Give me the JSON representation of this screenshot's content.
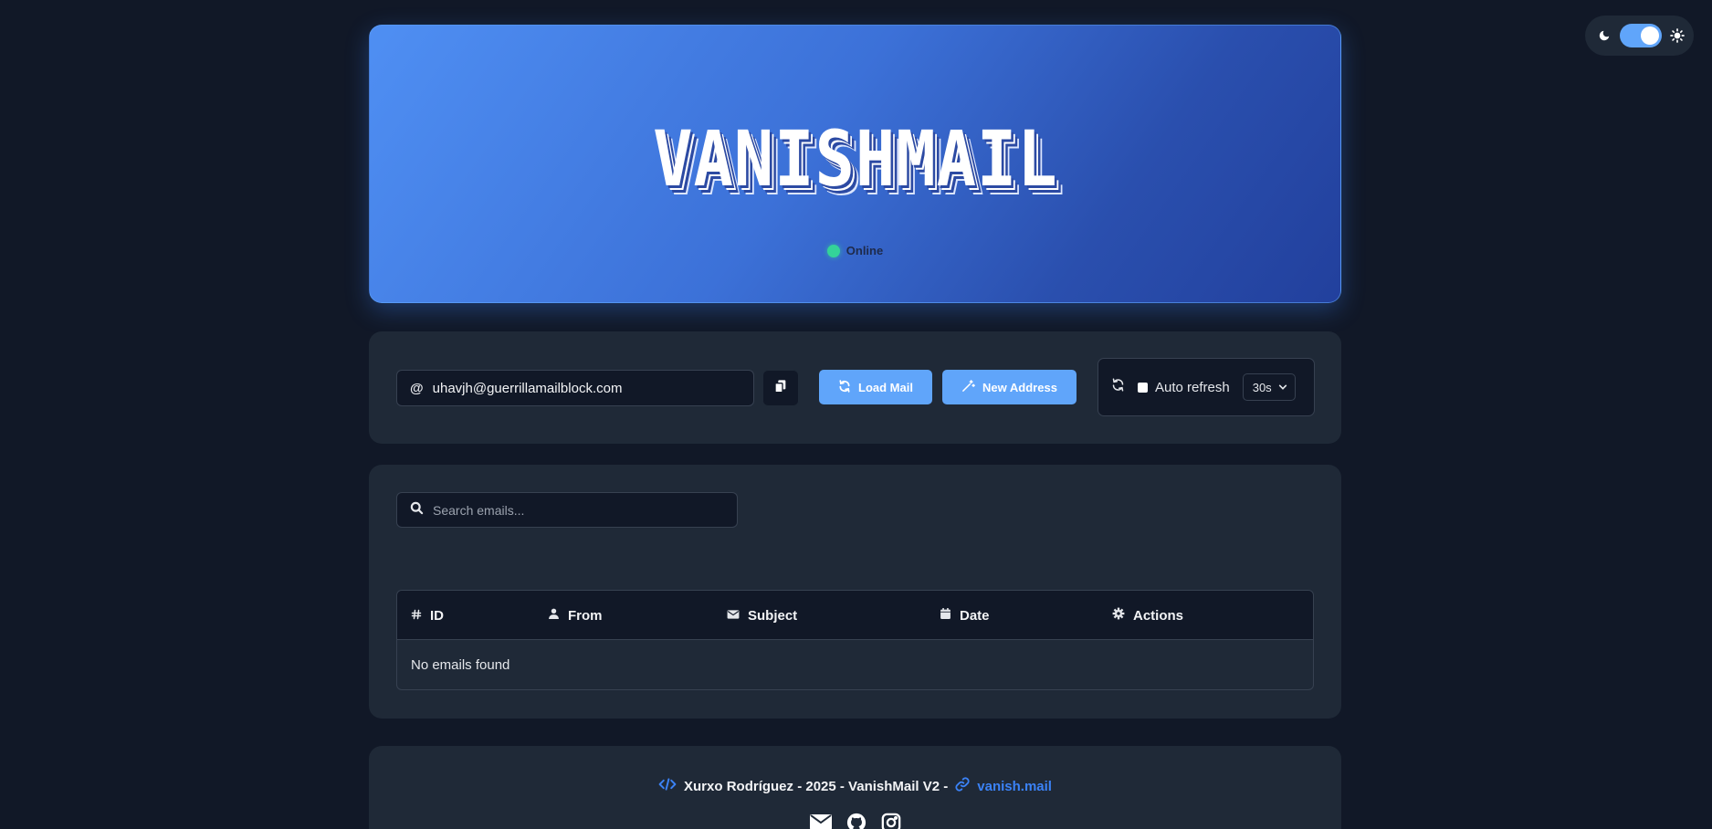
{
  "app": {
    "logo_text": "VANISHMAIL",
    "status_text": "Online"
  },
  "theme_toggle": {
    "moon_icon": "moon-icon",
    "sun_icon": "sun-icon",
    "state": "on"
  },
  "controls": {
    "email_value": "uhavjh@guerrillamailblock.com",
    "email_prefix_icon": "at-icon",
    "copy_icon": "copy-icon",
    "load_button": "Load Mail",
    "new_button": "New Address",
    "auto_refresh_label": "Auto refresh",
    "auto_refresh_checked": false,
    "interval_selected": "30s"
  },
  "inbox": {
    "search_placeholder": "Search emails...",
    "columns": {
      "id": "ID",
      "from": "From",
      "subject": "Subject",
      "date": "Date",
      "actions": "Actions"
    },
    "empty_message": "No emails found"
  },
  "footer": {
    "credit": "Xurxo Rodríguez - 2025 - VanishMail V2 -",
    "link_text": "vanish.mail",
    "social_icons": [
      "envelope-icon",
      "github-icon",
      "instagram-icon"
    ]
  },
  "colors": {
    "background": "#111827",
    "panel": "#1f2937",
    "accent": "#60a5fa",
    "link": "#3b82f6",
    "online": "#34d399"
  }
}
